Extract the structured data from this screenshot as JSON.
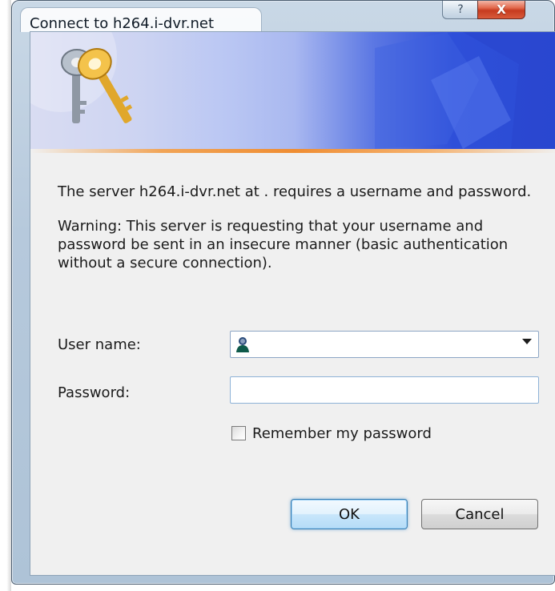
{
  "window": {
    "title": "Connect to h264.i-dvr.net",
    "help_glyph": "?",
    "close_glyph": "X"
  },
  "banner": {
    "icon": "keys-icon"
  },
  "message": {
    "line1": "The server h264.i-dvr.net at . requires a username and password.",
    "warning": "Warning: This server is requesting that your username and password be sent in an insecure manner (basic authentication without a secure connection)."
  },
  "form": {
    "username_label": "User name:",
    "username_value": "",
    "password_label": "Password:",
    "password_value": "",
    "remember_label": "Remember my password",
    "remember_checked": false
  },
  "buttons": {
    "ok": "OK",
    "cancel": "Cancel"
  },
  "colors": {
    "accent_blue": "#2b4bd3",
    "banner_orange": "#ef8d32",
    "close_red": "#c63b1f"
  }
}
